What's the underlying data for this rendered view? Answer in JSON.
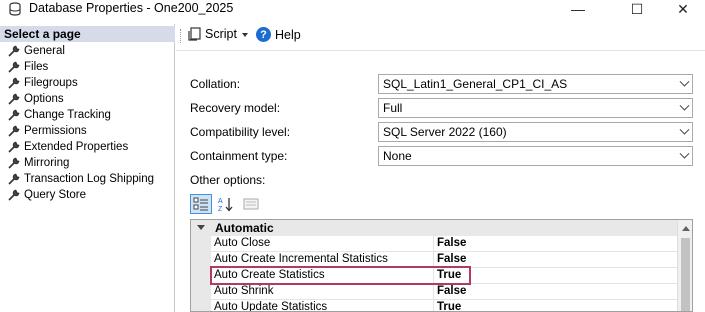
{
  "window": {
    "title": "Database Properties - One200_2025",
    "icon": "database-icon",
    "minimize_glyph": "—",
    "maximize_glyph": "☐",
    "close_glyph": "✕"
  },
  "left_pane": {
    "header": "Select a page",
    "items": [
      {
        "label": "General",
        "icon": "wrench-icon"
      },
      {
        "label": "Files",
        "icon": "wrench-icon"
      },
      {
        "label": "Filegroups",
        "icon": "wrench-icon"
      },
      {
        "label": "Options",
        "icon": "wrench-icon"
      },
      {
        "label": "Change Tracking",
        "icon": "wrench-icon"
      },
      {
        "label": "Permissions",
        "icon": "wrench-icon"
      },
      {
        "label": "Extended Properties",
        "icon": "wrench-icon"
      },
      {
        "label": "Mirroring",
        "icon": "wrench-icon"
      },
      {
        "label": "Transaction Log Shipping",
        "icon": "wrench-icon"
      },
      {
        "label": "Query Store",
        "icon": "wrench-icon"
      }
    ]
  },
  "toolbar": {
    "script_label": "Script",
    "help_label": "Help",
    "help_glyph": "?"
  },
  "form": {
    "collation": {
      "label": "Collation:",
      "value": "SQL_Latin1_General_CP1_CI_AS"
    },
    "recovery_model": {
      "label": "Recovery model:",
      "value": "Full"
    },
    "compatibility_level": {
      "label": "Compatibility level:",
      "value": "SQL Server 2022 (160)"
    },
    "containment_type": {
      "label": "Containment type:",
      "value": "None"
    },
    "other_options_label": "Other options:"
  },
  "property_grid": {
    "category": "Automatic",
    "rows": [
      {
        "name": "Auto Close",
        "value": "False"
      },
      {
        "name": "Auto Create Incremental Statistics",
        "value": "False"
      },
      {
        "name": "Auto Create Statistics",
        "value": "True"
      },
      {
        "name": "Auto Shrink",
        "value": "False"
      },
      {
        "name": "Auto Update Statistics",
        "value": "True"
      }
    ],
    "highlighted_row": "Auto Create Statistics"
  },
  "colors": {
    "highlight_border": "#b03a62",
    "header_background": "#d6dbe9",
    "help_icon": "#1c6dd0"
  }
}
